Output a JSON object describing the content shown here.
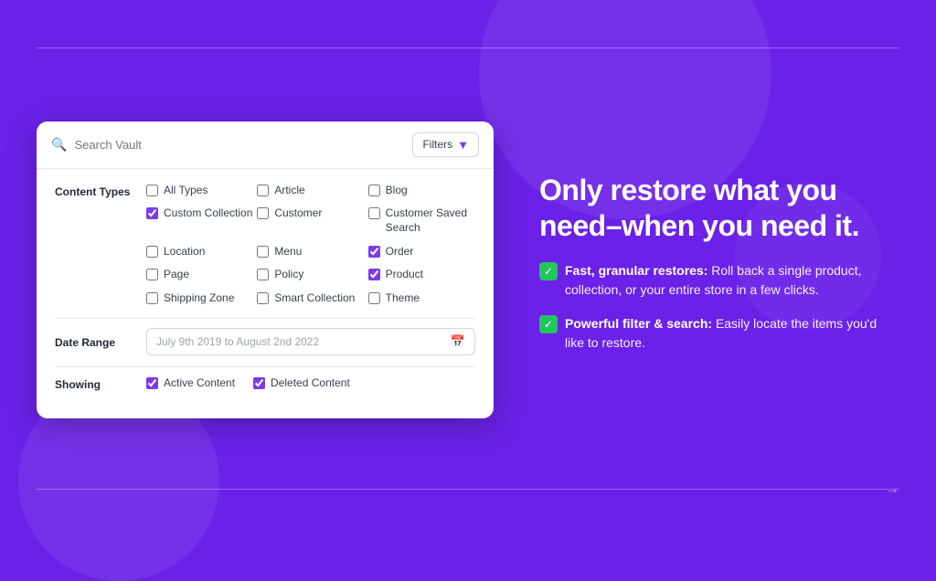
{
  "background": {
    "color": "#6B21E8"
  },
  "search": {
    "placeholder": "Search Vault",
    "filters_label": "Filters"
  },
  "content_types": {
    "label": "Content Types",
    "items": [
      {
        "id": "all-types",
        "label": "All Types",
        "checked": false
      },
      {
        "id": "article",
        "label": "Article",
        "checked": false
      },
      {
        "id": "blog",
        "label": "Blog",
        "checked": false
      },
      {
        "id": "custom-collection",
        "label": "Custom Collection",
        "checked": true
      },
      {
        "id": "customer",
        "label": "Customer",
        "checked": false
      },
      {
        "id": "customer-saved-search",
        "label": "Customer Saved Search",
        "checked": false
      },
      {
        "id": "location",
        "label": "Location",
        "checked": false
      },
      {
        "id": "menu",
        "label": "Menu",
        "checked": false
      },
      {
        "id": "order",
        "label": "Order",
        "checked": true
      },
      {
        "id": "page",
        "label": "Page",
        "checked": false
      },
      {
        "id": "policy",
        "label": "Policy",
        "checked": false
      },
      {
        "id": "product",
        "label": "Product",
        "checked": true
      },
      {
        "id": "shipping-zone",
        "label": "Shipping Zone",
        "checked": false
      },
      {
        "id": "smart-collection",
        "label": "Smart Collection",
        "checked": false
      },
      {
        "id": "theme",
        "label": "Theme",
        "checked": false
      }
    ]
  },
  "date_range": {
    "label": "Date Range",
    "placeholder": "July 9th 2019 to August 2nd 2022"
  },
  "showing": {
    "label": "Showing",
    "items": [
      {
        "id": "active-content",
        "label": "Active Content",
        "checked": true
      },
      {
        "id": "deleted-content",
        "label": "Deleted Content",
        "checked": true
      }
    ]
  },
  "headline": "Only restore what you need–when you need it.",
  "features": [
    {
      "id": "feature-1",
      "title": "Fast, granular restores:",
      "description": " Roll back a single product, collection, or your entire store in a few clicks."
    },
    {
      "id": "feature-2",
      "title": "Powerful filter & search:",
      "description": " Easily locate the items you'd like to restore."
    }
  ]
}
